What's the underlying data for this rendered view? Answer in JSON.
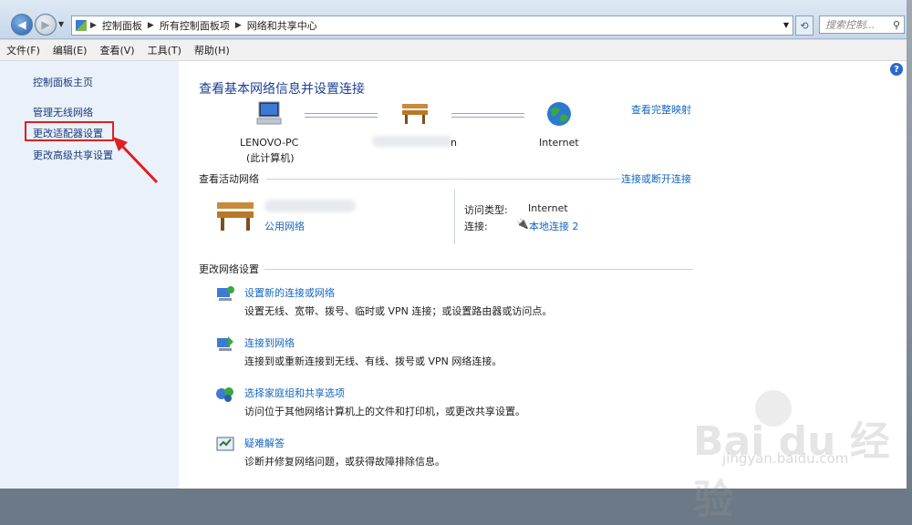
{
  "address_bar": {
    "crumbs": [
      "控制面板",
      "所有控制面板项",
      "网络和共享中心"
    ],
    "search_placeholder": "搜索控制..."
  },
  "menu": [
    "文件(F)",
    "编辑(E)",
    "查看(V)",
    "工具(T)",
    "帮助(H)"
  ],
  "sidebar": {
    "items": [
      {
        "label": "控制面板主页"
      },
      {
        "label": "管理无线网络"
      },
      {
        "label": "更改适配器设置"
      },
      {
        "label": "更改高级共享设置"
      }
    ]
  },
  "main": {
    "title": "查看基本网络信息并设置连接",
    "view_full_map": "查看完整映射",
    "nodes": {
      "computer_name": "LENOVO-PC",
      "computer_sub": "(此计算机)",
      "network_tail": "n",
      "internet": "Internet"
    },
    "active_section": "查看活动网络",
    "connect_disconnect": "连接或断开连接",
    "network_type": "公用网络",
    "access_type_label": "访问类型:",
    "access_type_value": "Internet",
    "connection_label": "连接:",
    "connection_value": "本地连接 2",
    "change_section": "更改网络设置",
    "tasks": [
      {
        "title": "设置新的连接或网络",
        "desc": "设置无线、宽带、拨号、临时或 VPN 连接；或设置路由器或访问点。"
      },
      {
        "title": "连接到网络",
        "desc": "连接到或重新连接到无线、有线、拨号或 VPN 网络连接。"
      },
      {
        "title": "选择家庭组和共享选项",
        "desc": "访问位于其他网络计算机上的文件和打印机，或更改共享设置。"
      },
      {
        "title": "疑难解答",
        "desc": "诊断并修复网络问题，或获得故障排除信息。"
      }
    ]
  },
  "watermark": {
    "brand": "Bai du 经验",
    "url": "jingyan.baidu.com"
  }
}
